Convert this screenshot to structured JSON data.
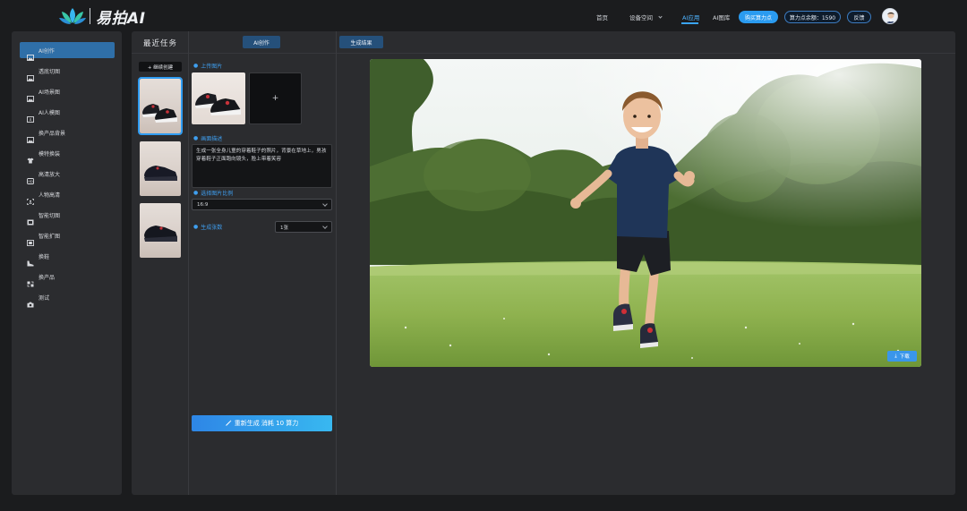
{
  "header": {
    "brand_name": "易拍AI",
    "nav": [
      {
        "label": "首页"
      },
      {
        "label": "设备空间"
      },
      {
        "label": "AI应用"
      },
      {
        "label": "AI图库"
      }
    ],
    "buy_button": "购买算力点",
    "balance": "算力点余额：1590",
    "feedback_button": "反馈",
    "accent_color": "#2a9bf0"
  },
  "sidebar": {
    "items": [
      {
        "label": "AI创作",
        "icon": "image-icon",
        "active": true
      },
      {
        "label": "透底切图",
        "icon": "image-icon"
      },
      {
        "label": "AI场景图",
        "icon": "image-icon"
      },
      {
        "label": "AI人模图",
        "icon": "ai-model-icon"
      },
      {
        "label": "换产品背景",
        "icon": "image-icon"
      },
      {
        "label": "模特换装",
        "icon": "shirt-icon"
      },
      {
        "label": "高清放大",
        "icon": "hd-icon"
      },
      {
        "label": "人物高清",
        "icon": "person-frame-icon"
      },
      {
        "label": "智能切图",
        "icon": "cut-image-icon"
      },
      {
        "label": "智能扩图",
        "icon": "expand-image-icon"
      },
      {
        "label": "换鞋",
        "icon": "shoe-icon"
      },
      {
        "label": "换产品",
        "icon": "swap-product-icon"
      },
      {
        "label": "测试",
        "icon": "camera-icon"
      }
    ]
  },
  "recent": {
    "title": "最近任务",
    "new_button": "+ 继续创建"
  },
  "tabs": {
    "create": "AI创作",
    "result": "生成结果"
  },
  "form": {
    "upload_label": "上传图片",
    "upload_add": "+",
    "prompt_label": "画面描述",
    "prompt_text": "生成一张全身儿童的穿着鞋子的照片，背景在草地上，男孩穿着鞋子正面跑向镜头，脸上带着笑容",
    "ratio_label": "选择图片比例",
    "ratio_value": "16:9",
    "count_label": "生成张数",
    "count_value": "1张",
    "regen_button": "重新生成 消耗 10 算力"
  },
  "result": {
    "download_button": "下载"
  }
}
